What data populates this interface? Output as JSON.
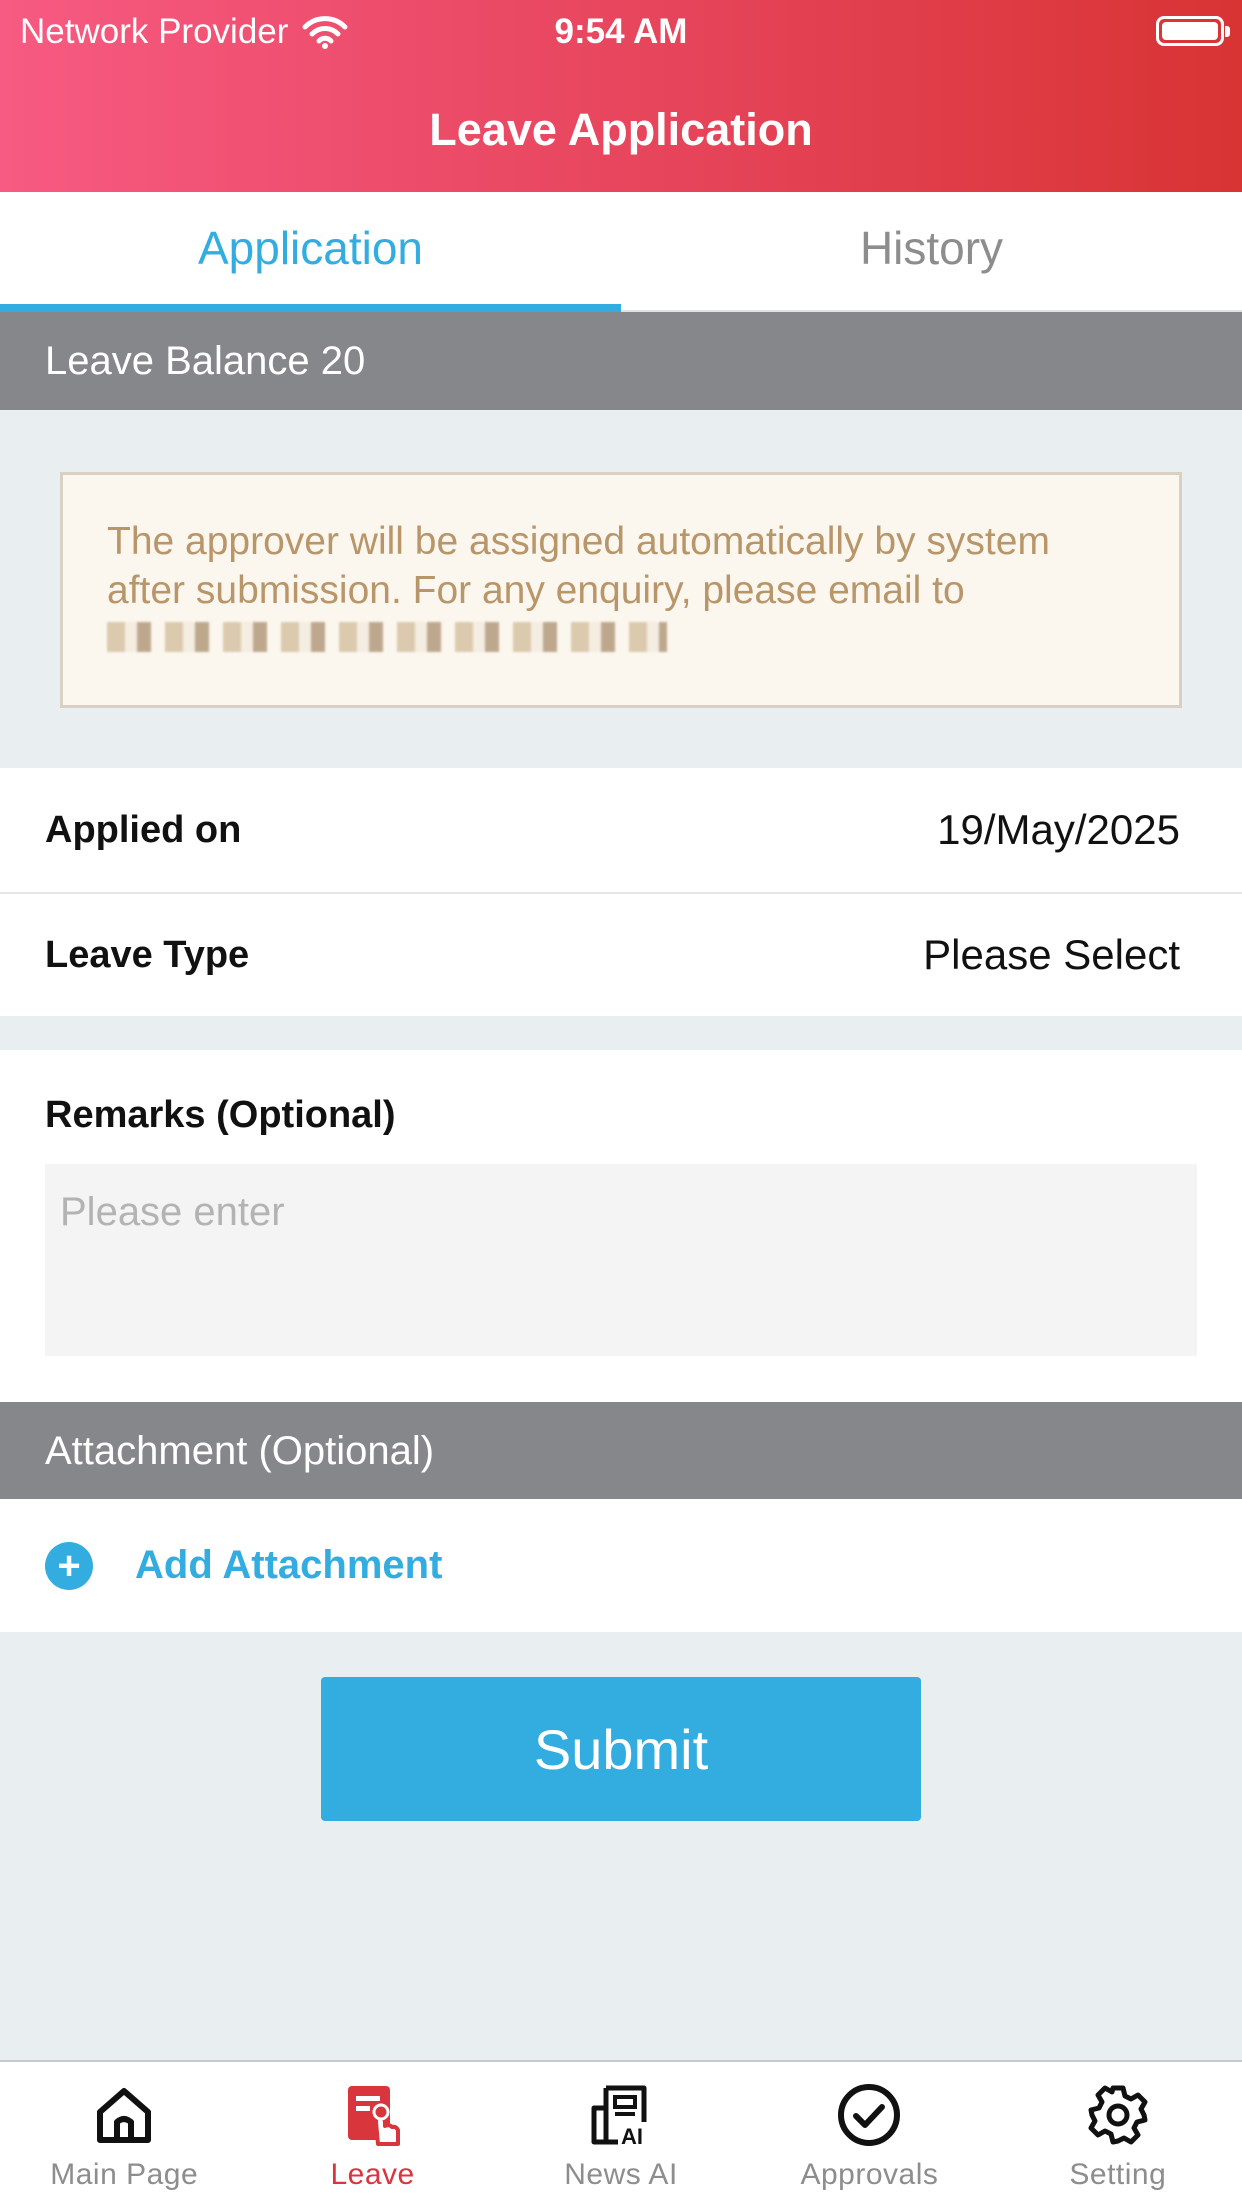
{
  "status_bar": {
    "carrier": "Network Provider",
    "time": "9:54 AM"
  },
  "header": {
    "title": "Leave Application"
  },
  "tabs": [
    {
      "label": "Application",
      "active": true
    },
    {
      "label": "History",
      "active": false
    }
  ],
  "leave_balance": "Leave Balance 20",
  "notice": {
    "text_line1": "The approver will be assigned automatically by system",
    "text_line2": "after submission. For any enquiry, please email to"
  },
  "form": {
    "applied_on_label": "Applied on",
    "applied_on_value": "19/May/2025",
    "leave_type_label": "Leave Type",
    "leave_type_value": "Please Select",
    "remarks_label": "Remarks (Optional)",
    "remarks_placeholder": "Please enter",
    "remarks_value": ""
  },
  "attachment": {
    "section_title": "Attachment (Optional)",
    "add_label": "Add Attachment"
  },
  "submit_label": "Submit",
  "bottom_nav": [
    {
      "label": "Main Page",
      "icon": "home-icon",
      "active": false
    },
    {
      "label": "Leave",
      "icon": "leave-icon",
      "active": true
    },
    {
      "label": "News AI",
      "icon": "news-ai-icon",
      "active": false
    },
    {
      "label": "Approvals",
      "icon": "check-circle-icon",
      "active": false
    },
    {
      "label": "Setting",
      "icon": "gear-icon",
      "active": false
    }
  ],
  "colors": {
    "header_gradient_start": "#f75a82",
    "header_gradient_end": "#d83434",
    "accent_blue": "#33ade0",
    "active_nav_red": "#d8353d",
    "section_gray": "#85878b",
    "notice_text": "#b9966a"
  }
}
